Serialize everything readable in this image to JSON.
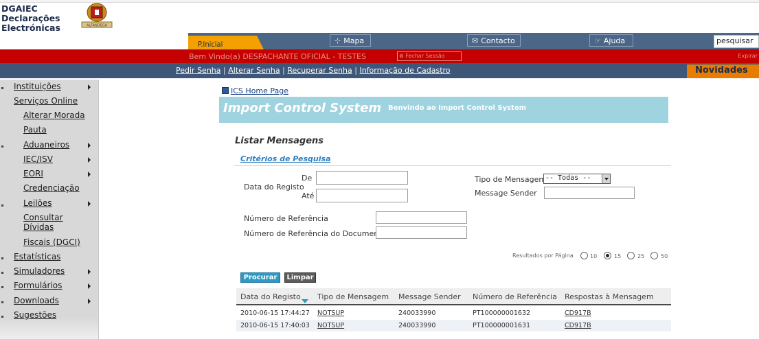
{
  "header": {
    "logo_lines": [
      "DGAIEC",
      "Declarações",
      "Electrónicas"
    ],
    "crest_caption": "ALFANDEGA"
  },
  "nav": {
    "inicial": "P.Inicial",
    "mapa": "Mapa",
    "contacto": "Contacto",
    "ajuda": "Ajuda",
    "search_value": "pesquisar"
  },
  "welcome": {
    "text": "Bem Vindo(a) DESPACHANTE OFICIAL - TESTES",
    "logout": "Fechar Sessão",
    "sair": "Expirar"
  },
  "links": {
    "pedir": "Pedir Senha",
    "alterar": "Alterar Senha",
    "recuperar": "Recuperar Senha",
    "informacao": "Informação de Cadastro",
    "sep": "|"
  },
  "novidades": "Novidades",
  "sidebar": {
    "items": [
      {
        "label": "Instituições"
      },
      {
        "label": "Serviços Online"
      },
      {
        "label": "Alterar Morada"
      },
      {
        "label": "Pauta"
      },
      {
        "label": "Aduaneiros"
      },
      {
        "label": "IEC/ISV"
      },
      {
        "label": "EORI"
      },
      {
        "label": "Credenciação"
      },
      {
        "label": "Leilões"
      },
      {
        "label": "Consultar"
      },
      {
        "label": "Dívidas"
      },
      {
        "label": "Fiscais (DGCI)"
      },
      {
        "label": "Estatísticas"
      },
      {
        "label": "Simuladores"
      },
      {
        "label": "Formulários"
      },
      {
        "label": "Downloads"
      },
      {
        "label": "Sugestões"
      }
    ]
  },
  "main": {
    "home_link": "ICS Home Page",
    "banner_title": "Import Control System",
    "banner_sub": "Benvindo ao Import Control System",
    "page_title": "Listar Mensagens",
    "criteria": "Critérios de Pesquisa",
    "form": {
      "data_registo": "Data do Registo",
      "de": "De",
      "ate": "Até",
      "tipo_mensagem": "Tipo de Mensagem",
      "tipo_value": "-- Todas --",
      "message_sender": "Message Sender",
      "num_ref": "Número de Referência",
      "num_ref_doc": "Número de Referência do Documento",
      "resultados": "Resultados por Página",
      "per_page_options": [
        "10",
        "15",
        "25",
        "50"
      ],
      "per_page_selected": "15"
    },
    "buttons": {
      "procurar": "Procurar",
      "limpar": "Limpar"
    },
    "table": {
      "headers": [
        "Data do Registo",
        "Tipo de Mensagem",
        "Message Sender",
        "Número de Referência",
        "Respostas à Mensagem"
      ],
      "rows": [
        [
          "2010-06-15 17:44:27",
          "NOTSUP",
          "240033990",
          "PT100000001632",
          "CD917B"
        ],
        [
          "2010-06-15 17:40:03",
          "NOTSUP",
          "240033990",
          "PT100000001631",
          "CD917B"
        ]
      ]
    }
  }
}
